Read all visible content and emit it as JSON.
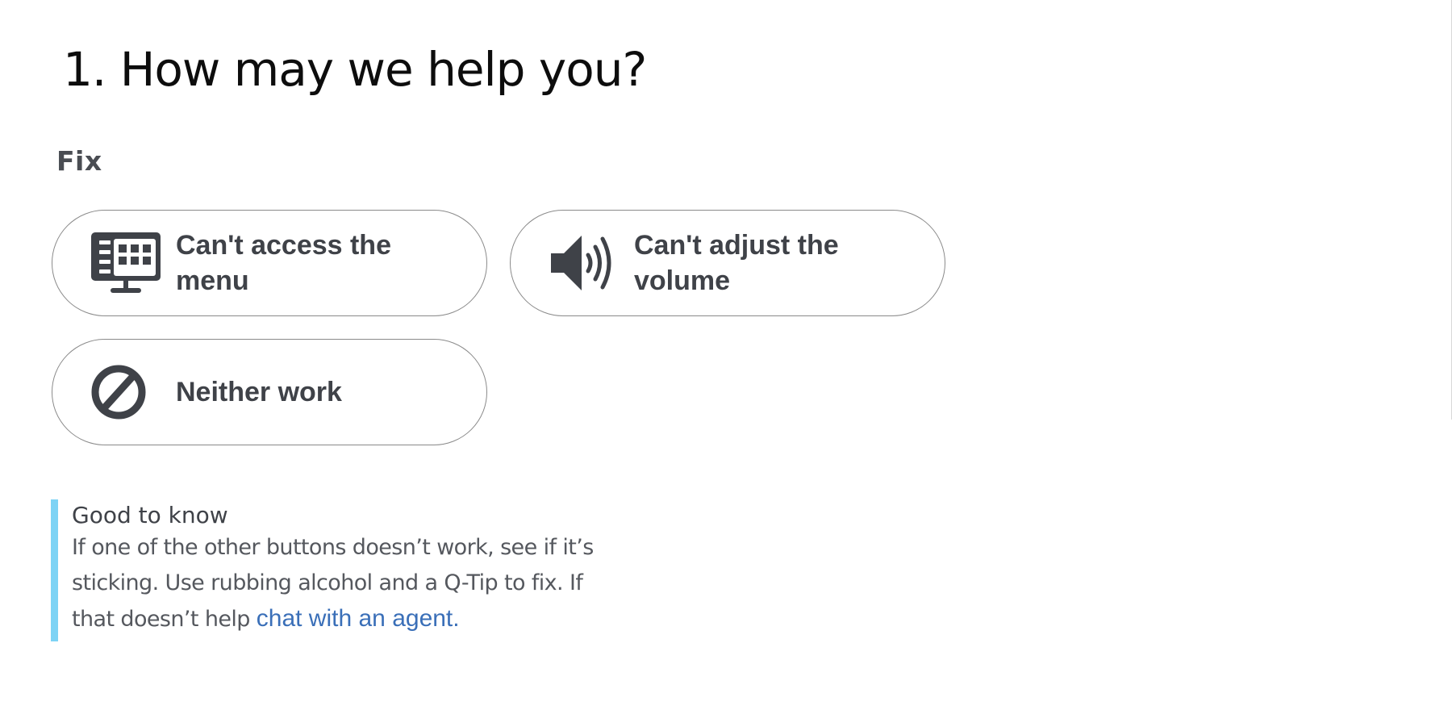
{
  "page": {
    "title": "1. How may we help you?",
    "section_label": "Fix"
  },
  "options": [
    {
      "label": "Can't access the menu",
      "icon": "tv-menu-icon"
    },
    {
      "label": "Can't adjust the volume",
      "icon": "volume-icon"
    },
    {
      "label": "Neither work",
      "icon": "prohibited-icon"
    }
  ],
  "notice": {
    "title": "Good to know",
    "body": "If one of the other buttons doesn’t work, see if it’s sticking. Use rubbing alcohol and a Q-Tip to fix. If that doesn’t help ",
    "link_text": "chat with an agent."
  },
  "colors": {
    "text": "#3f4248",
    "border": "#8a8a8a",
    "accent_bar": "#7dd3f5",
    "link": "#3a6fb8"
  }
}
